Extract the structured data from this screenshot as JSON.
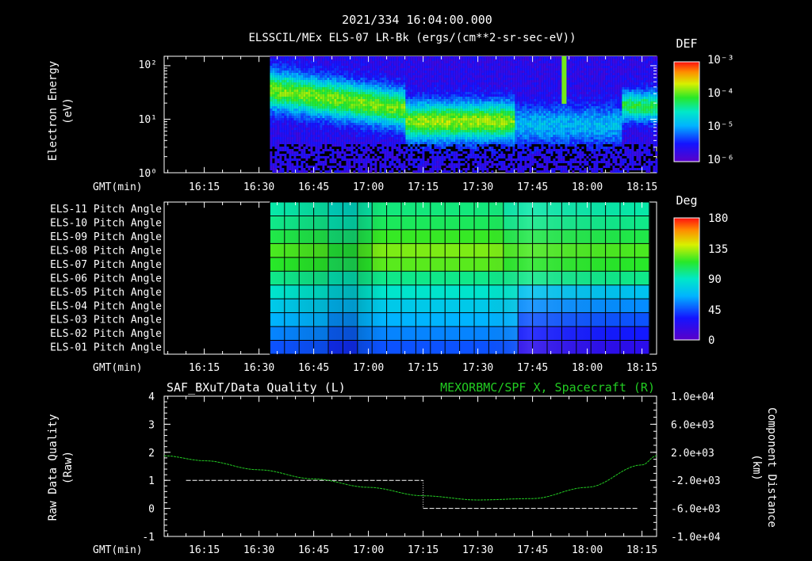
{
  "header": {
    "timestamp": "2021/334 16:04:00.000",
    "subtitle": "ELSSCIL/MEx ELS-07 LR-Bk  (ergs/(cm**2-sr-sec-eV))"
  },
  "colors": {
    "background": "#000000",
    "foreground": "#ffffff",
    "right_axis_color": "#22cc22",
    "quality_line": "#ffffff"
  },
  "gmt_label": "GMT(min)",
  "time_ticks": [
    "16:15",
    "16:30",
    "16:45",
    "17:00",
    "17:15",
    "17:30",
    "17:45",
    "18:00",
    "18:15"
  ],
  "chart_data": [
    {
      "type": "heatmap",
      "ylabel_line1": "Electron Energy",
      "ylabel_line2": "(eV)",
      "ylim": [
        1,
        150
      ],
      "yscale": "log",
      "y_ticks": [
        "10²",
        "10¹",
        "10⁰"
      ],
      "colorbar": {
        "title": "DEF",
        "scale": "log",
        "ticks": [
          "10⁻³",
          "10⁻⁴",
          "10⁻⁵",
          "10⁻⁶"
        ],
        "range": [
          1e-06,
          0.001
        ]
      },
      "x_range": [
        "16:04",
        "18:19"
      ],
      "data_start": "16:33",
      "data_end": "18:19"
    },
    {
      "type": "heatmap",
      "row_labels": [
        "ELS-11 Pitch Angle",
        "ELS-10 Pitch Angle",
        "ELS-09 Pitch Angle",
        "ELS-08 Pitch Angle",
        "ELS-07 Pitch Angle",
        "ELS-06 Pitch Angle",
        "ELS-05 Pitch Angle",
        "ELS-04 Pitch Angle",
        "ELS-03 Pitch Angle",
        "ELS-02 Pitch Angle",
        "ELS-01 Pitch Angle"
      ],
      "colorbar": {
        "title": "Deg",
        "ticks": [
          "180",
          "135",
          "90",
          "45",
          "0"
        ],
        "range": [
          0,
          180
        ]
      },
      "data_start": "16:33",
      "data_end": "18:17",
      "approx_pitch_angles_deg": {
        "ELS-11": 95,
        "ELS-10": 100,
        "ELS-09": 110,
        "ELS-08": 120,
        "ELS-07": 115,
        "ELS-06": 100,
        "ELS-05": 88,
        "ELS-04": 75,
        "ELS-03": 65,
        "ELS-02": 55,
        "ELS-01": 45
      }
    },
    {
      "type": "line",
      "title_left": "SAF_BXuT/Data Quality (L)",
      "title_right": "MEXORBMC/SPF X, Spacecraft (R)",
      "ylabel_left_line1": "Raw Data Quality",
      "ylabel_left_line2": "(Raw)",
      "ylabel_right_line1": "Component Distance",
      "ylabel_right_line2": "(km)",
      "ylim": [
        -1,
        4
      ],
      "y_ticks_left": [
        "4",
        "3",
        "2",
        "1",
        "0",
        "-1"
      ],
      "y2lim": [
        -10000,
        10000
      ],
      "y_ticks_right": [
        "1.0e+04",
        "6.0e+03",
        "2.0e+03",
        "-2.0e+03",
        "-6.0e+03",
        "-1.0e+04"
      ],
      "series": [
        {
          "name": "SAF_BXuT/Data Quality",
          "axis": "left",
          "segments": [
            {
              "x_start": "16:10",
              "x_end": "17:15",
              "value": 1
            },
            {
              "x_start": "17:15",
              "x_end": "18:14",
              "value": 0
            }
          ]
        },
        {
          "name": "MEXORBMC/SPF X, Spacecraft",
          "axis": "right",
          "x": [
            "16:04",
            "16:15",
            "16:30",
            "16:45",
            "17:00",
            "17:15",
            "17:30",
            "17:45",
            "18:00",
            "18:15",
            "18:19"
          ],
          "values": [
            1500,
            800,
            -500,
            -1800,
            -3000,
            -4200,
            -4800,
            -4600,
            -3000,
            200,
            1500
          ]
        }
      ]
    }
  ]
}
